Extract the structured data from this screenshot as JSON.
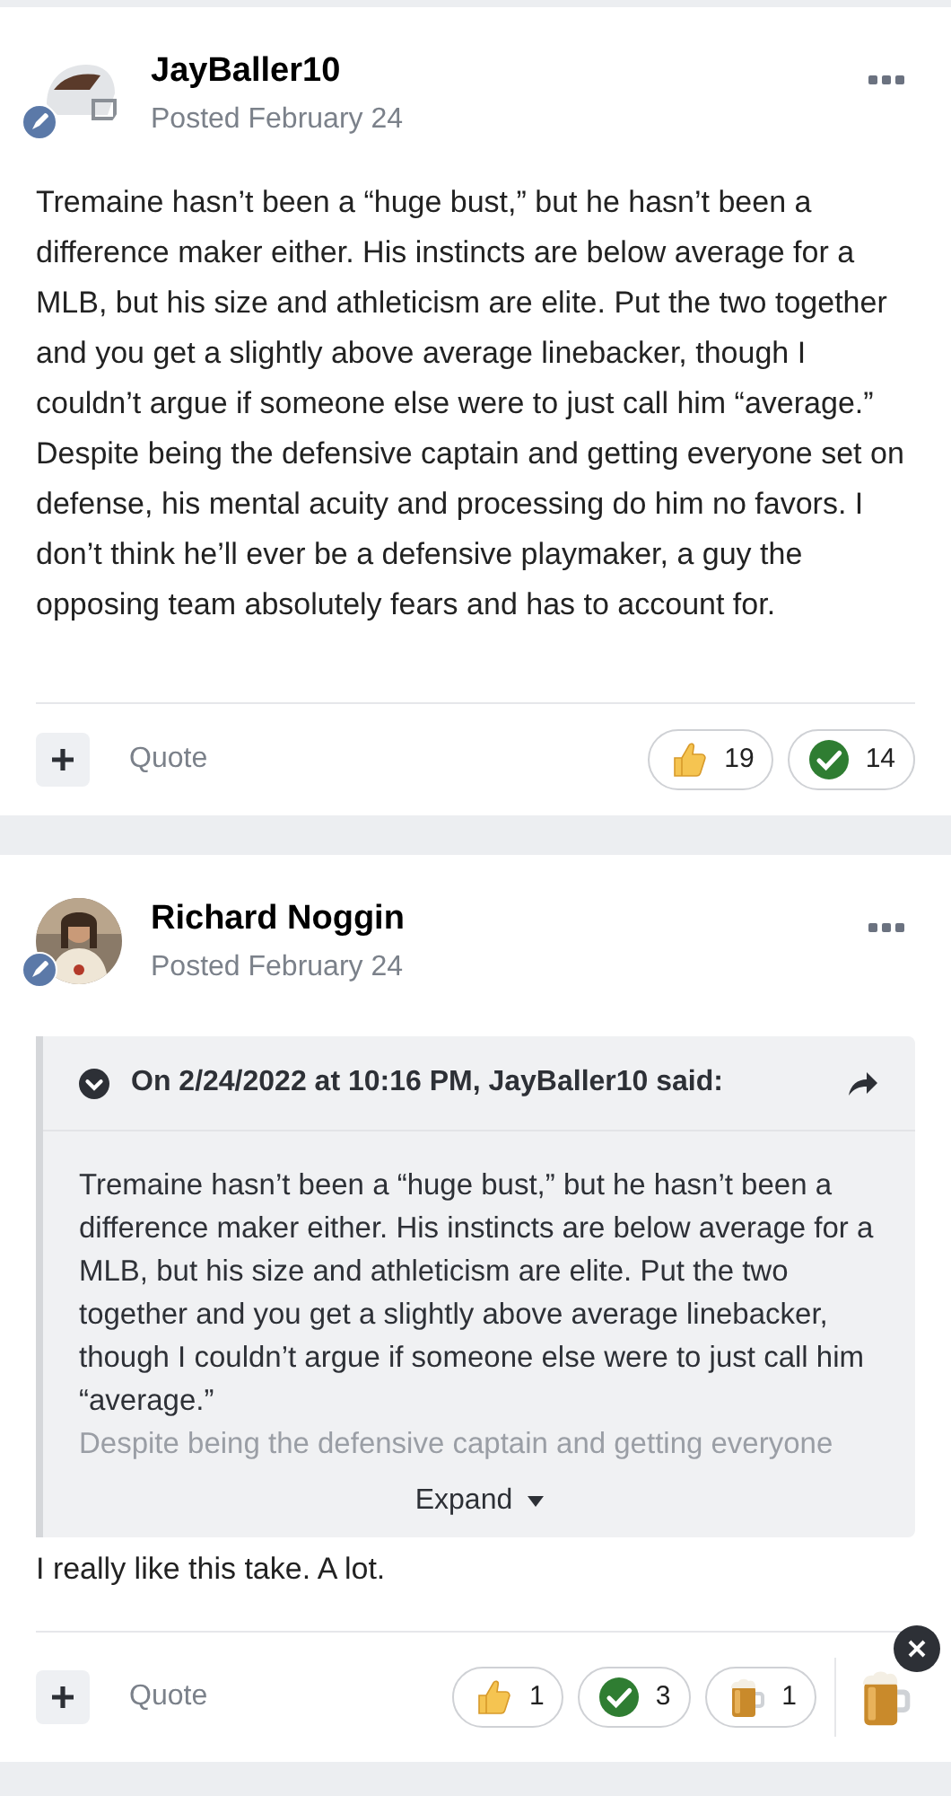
{
  "posts": [
    {
      "author": "JayBaller10",
      "posted": "Posted February 24",
      "avatar": {
        "kind": "picture"
      },
      "body": "Tremaine hasn’t been a “huge bust,” but he hasn’t been a difference maker either. His instincts are below average for a MLB, but his size and athleticism are elite. Put the two together and you get a slightly above average linebacker, though I couldn’t argue if someone else were to just call him “average.” Despite being the defensive captain and getting everyone set on defense, his mental acuity and processing do him no favors. I don’t think he’ll ever be a defensive playmaker, a guy the opposing team absolutely fears and has to account for.",
      "quote_label": "Quote",
      "reactions": [
        {
          "kind": "thumb",
          "count": "19"
        },
        {
          "kind": "check",
          "count": "14"
        }
      ]
    },
    {
      "author": "Richard Noggin",
      "posted": "Posted February 24",
      "avatar": {
        "kind": "picture"
      },
      "quote": {
        "header": "On 2/24/2022 at 10:16 PM, JayBaller10 said:",
        "text": "Tremaine hasn’t been a “huge bust,” but he hasn’t been a difference maker either. His instincts are below average for a MLB, but his size and athleticism are elite. Put the two together and you get a slightly above average linebacker, though I couldn’t argue if someone else were to just call him “average.”",
        "faded_text": "Despite being the defensive captain and getting everyone",
        "expand": "Expand"
      },
      "body": "I really like this take. A lot.",
      "quote_label": "Quote",
      "reactions": [
        {
          "kind": "thumb",
          "count": "1"
        },
        {
          "kind": "check",
          "count": "3"
        },
        {
          "kind": "beer",
          "count": "1"
        }
      ],
      "reaction_picker": {
        "kind": "beer"
      }
    }
  ]
}
